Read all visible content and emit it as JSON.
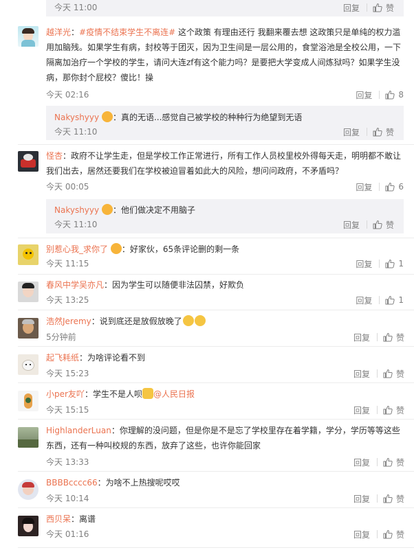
{
  "labels": {
    "reply": "回复",
    "like": "赞"
  },
  "top_reply": {
    "time": "今天 11:00"
  },
  "comments": [
    {
      "user": "越洋光",
      "topic": "#疫情不结束学生不离连#",
      "text": " 这个政策 有理由还行 我翻来覆去想 这政策只是单纯的权力滥用加脑残。如果学生有病，封校等于团灭，因为卫生间是一层公用的，食堂浴池是全校公用，一下隔离加治疗一个学校的学生，请问大连zf有这个能力吗？是要把大学变成人间炼狱吗？如果学生没病，那你封个屁校？傻比！操",
      "time": "今天 02:16",
      "likes": "8",
      "reply": {
        "user": "Nakyshyyy",
        "text": "：真的无语...感觉自己被学校的种种行为绝望到无语",
        "time": "今天 11:10"
      }
    },
    {
      "user": "怪杏",
      "text": "：政府不让学生走，但是学校工作正常进行，所有工作人员校里校外得每天走，明明都不敢让我们出去，居然还要我们在学校被迫冒着如此大的风险，想问问政府，不矛盾吗？",
      "time": "今天 00:05",
      "likes": "6",
      "reply": {
        "user": "Nakyshyyy",
        "text": "：他们做决定不用脑子",
        "time": "今天 11:10"
      }
    },
    {
      "user": "别惹心我_求你了",
      "text": "：好家伙，65条评论删的剩一条",
      "time": "今天 11:15",
      "likes": "1"
    },
    {
      "user": "春风中学吴亦凡",
      "text": "：因为学生可以随便非法囚禁，好欺负",
      "time": "今天 13:25",
      "likes": "1"
    },
    {
      "user": "浩然Jeremy",
      "text": "：说到底还是放假放晚了",
      "time": "5分钟前",
      "likes": ""
    },
    {
      "user": "起飞耗纸",
      "text": "：为啥评论看不到",
      "time": "今天 15:23",
      "likes": ""
    },
    {
      "user": "小per友吖",
      "text": "：学生不是人呗",
      "mention": "@人民日报",
      "time": "今天 15:15",
      "likes": ""
    },
    {
      "user": "HighlanderLuan",
      "text": "：你理解的没问题，但是你是不是忘了学校里存在着学籍，学分，学历等等这些东西，还有一种叫校规的东西，放弃了这些，也许你能回家",
      "time": "今天 13:33",
      "likes": ""
    },
    {
      "user": "BBBBcccc66",
      "text": "：为啥不上热搜呢哎哎",
      "time": "今天 10:14",
      "likes": ""
    },
    {
      "user": "西贝呆",
      "text": "：离谱",
      "time": "今天 01:16",
      "likes": ""
    }
  ],
  "colors": {
    "username": "#eb7350",
    "reply_bg": "#f2f2f5",
    "meta": "#808080"
  }
}
